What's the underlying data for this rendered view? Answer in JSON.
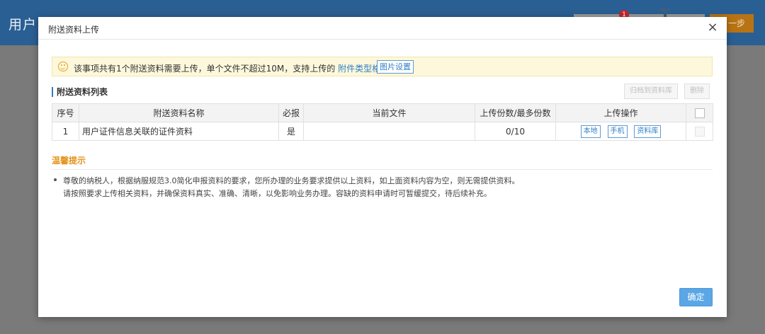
{
  "background": {
    "app_title": "用户",
    "badge_count": "1",
    "next_label": "一步"
  },
  "modal": {
    "title": "附送资料上传",
    "close_symbol": "×",
    "notice": {
      "text": "该事项共有1个附送资料需要上传，单个文件不超过10M，支持上传的",
      "link": "附件类型格式",
      "button": "图片设置"
    },
    "section_title": "附送资料列表",
    "archive_button": "归档到资料库",
    "delete_button": "删除",
    "table": {
      "headers": [
        "序号",
        "附送资料名称",
        "必报",
        "当前文件",
        "上传份数/最多份数",
        "上传操作"
      ],
      "rows": [
        {
          "index": "1",
          "name": "用户证件信息关联的证件资料",
          "required": "是",
          "current_file": "",
          "count": "0/10",
          "actions": [
            "本地",
            "手机",
            "资料库"
          ]
        }
      ]
    },
    "tips_title": "温馨提示",
    "tips_line1": "尊敬的纳税人，根据纳服规范3.0简化申报资料的要求，您所办理的业务要求提供以上资料，如上面资料内容为空，则无需提供资料。",
    "tips_line2": "请按照要求上传相关资料，并确保资料真实、准确、清晰，以免影响业务办理。容缺的资料申请时可暂缓提交，待后续补充。",
    "confirm_button": "确定"
  }
}
